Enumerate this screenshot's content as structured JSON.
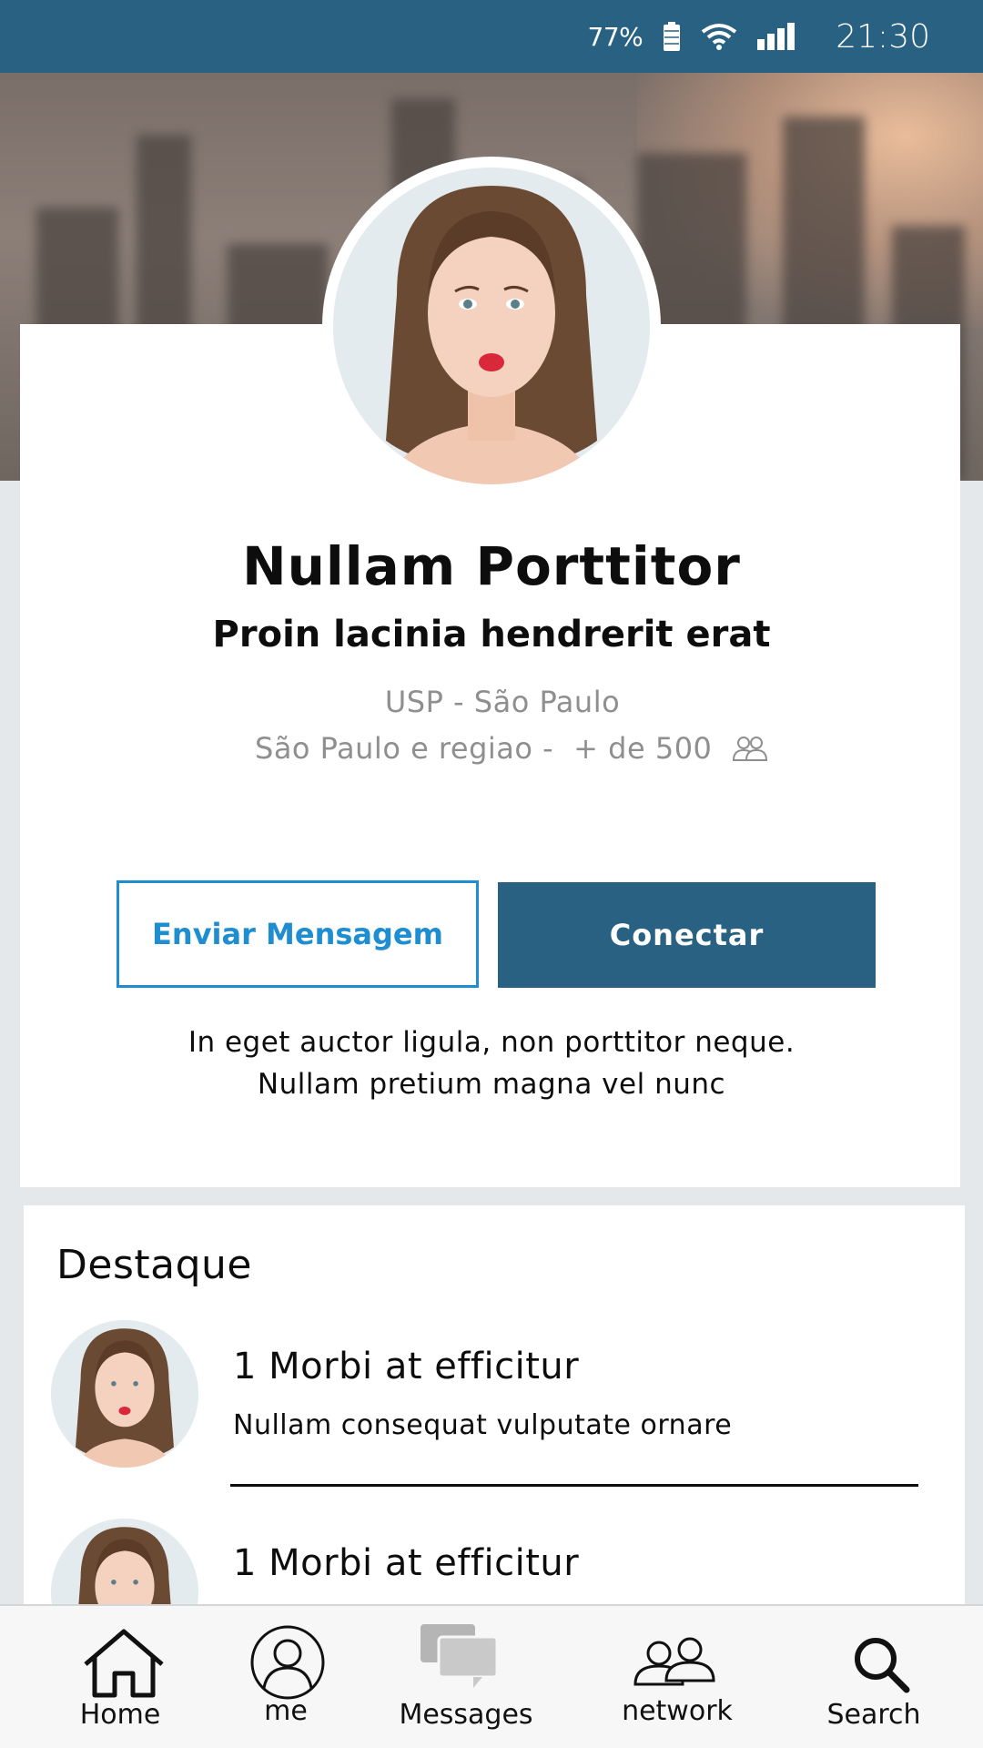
{
  "status_bar": {
    "battery_percent": "77%",
    "time": "21:30",
    "icons": [
      "battery-icon",
      "wifi-icon",
      "signal-icon"
    ]
  },
  "profile": {
    "name": "Nullam Porttitor",
    "headline": "Proin lacinia hendrerit erat",
    "school": "USP - São Paulo",
    "location": "São Paulo e regiao -",
    "connections": "+ de 500",
    "summary_line1": "In eget auctor ligula, non porttitor neque.",
    "summary_line2": "Nullam pretium magna vel nunc"
  },
  "actions": {
    "message_label": "Enviar Mensagem",
    "connect_label": "Conectar"
  },
  "highlights": {
    "title": "Destaque",
    "items": [
      {
        "title": "1 Morbi at efficitur",
        "subtitle": "Nullam consequat vulputate ornare"
      },
      {
        "title": "1 Morbi at efficitur"
      }
    ]
  },
  "nav": {
    "items": [
      {
        "label": "Home",
        "icon": "home-icon"
      },
      {
        "label": "me",
        "icon": "profile-icon"
      },
      {
        "label": "Messages",
        "icon": "messages-icon"
      },
      {
        "label": "network",
        "icon": "network-icon"
      },
      {
        "label": "Search",
        "icon": "search-icon"
      }
    ]
  },
  "colors": {
    "primary": "#286181",
    "accent": "#1e8ed0",
    "background": "#e4e8eb",
    "muted_text": "#8f8f8f"
  }
}
